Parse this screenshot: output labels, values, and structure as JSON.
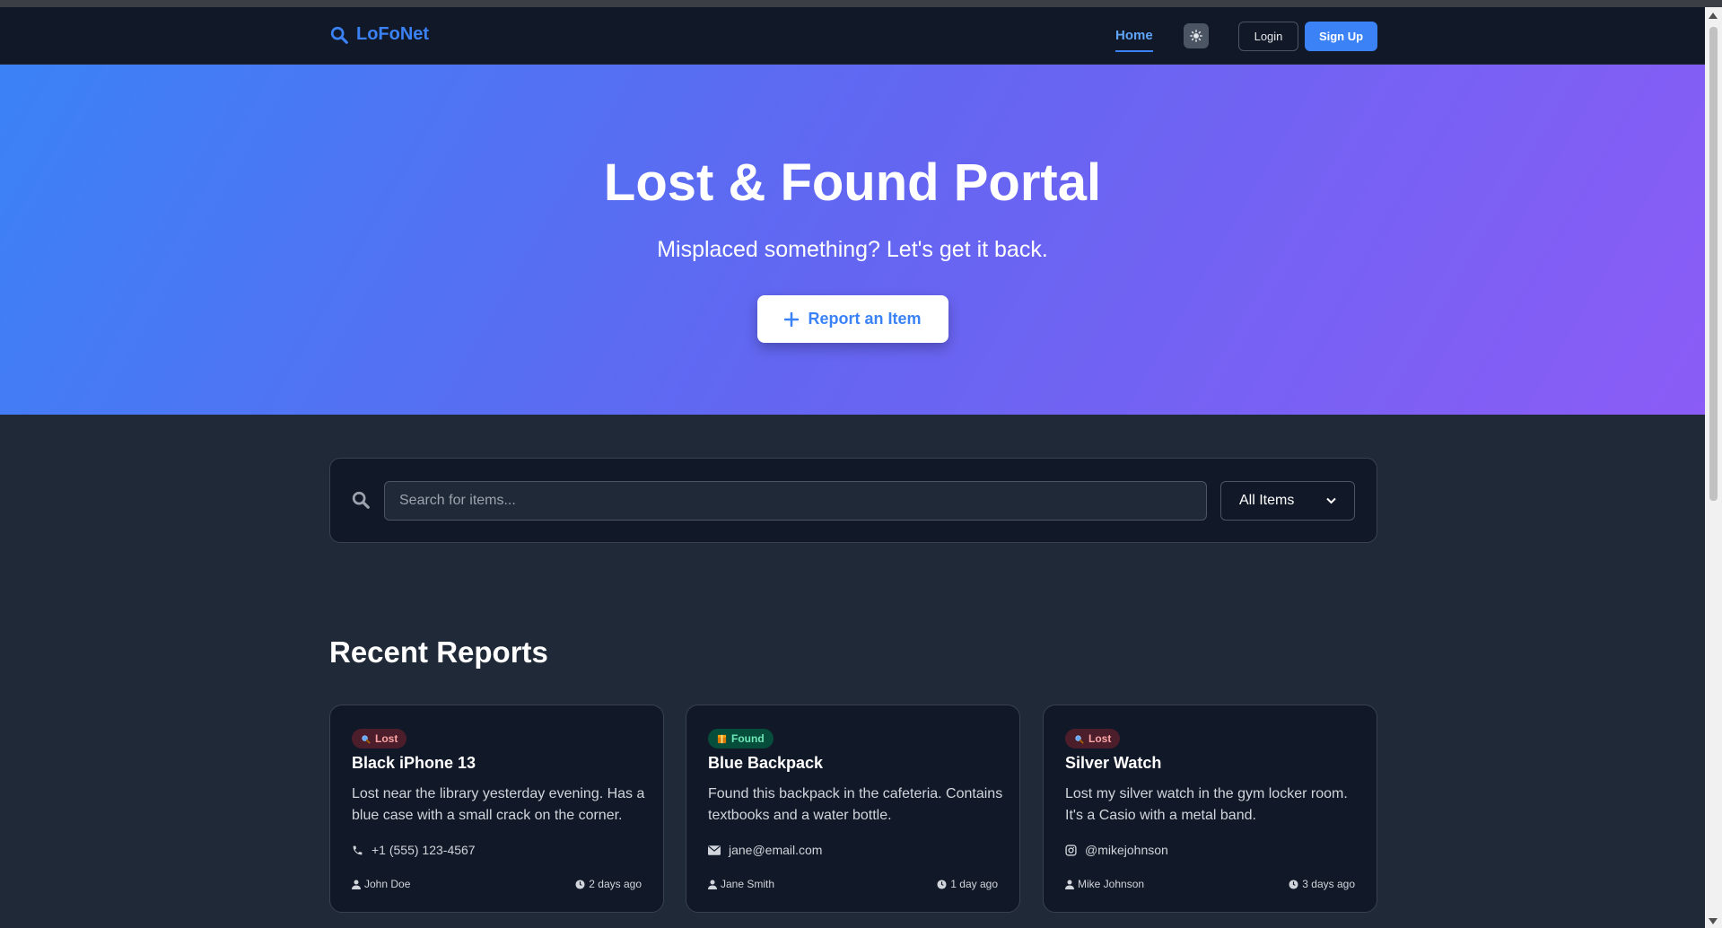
{
  "nav": {
    "brand": "LoFoNet",
    "home": "Home",
    "login": "Login",
    "signup": "Sign Up"
  },
  "hero": {
    "title": "Lost & Found Portal",
    "subtitle": "Misplaced something? Let's get it back.",
    "cta": "Report an Item"
  },
  "search": {
    "placeholder": "Search for items...",
    "filter_selected": "All Items"
  },
  "section": {
    "title": "Recent Reports"
  },
  "cards": [
    {
      "status": "Lost",
      "title": "Black iPhone 13",
      "description": "Lost near the library yesterday evening. Has a blue case with a small crack on the corner.",
      "contact_icon": "phone-icon",
      "contact": "+1 (555) 123-4567",
      "user": "John Doe",
      "time": "2 days ago"
    },
    {
      "status": "Found",
      "title": "Blue Backpack",
      "description": "Found this backpack in the cafeteria. Contains textbooks and a water bottle.",
      "contact_icon": "envelope-icon",
      "contact": "jane@email.com",
      "user": "Jane Smith",
      "time": "1 day ago"
    },
    {
      "status": "Lost",
      "title": "Silver Watch",
      "description": "Lost my silver watch in the gym locker room. It's a Casio with a metal band.",
      "contact_icon": "instagram-icon",
      "contact": "@mikejohnson",
      "user": "Mike Johnson",
      "time": "3 days ago"
    }
  ],
  "colors": {
    "accent": "#3b82f6",
    "hero_gradient_start": "#3b82f6",
    "hero_gradient_end": "#8b5cf6",
    "page_bg": "#1f2937",
    "nav_bg": "#111827",
    "lost_badge_bg": "#4c1d2a",
    "found_badge_bg": "#064e3b"
  }
}
